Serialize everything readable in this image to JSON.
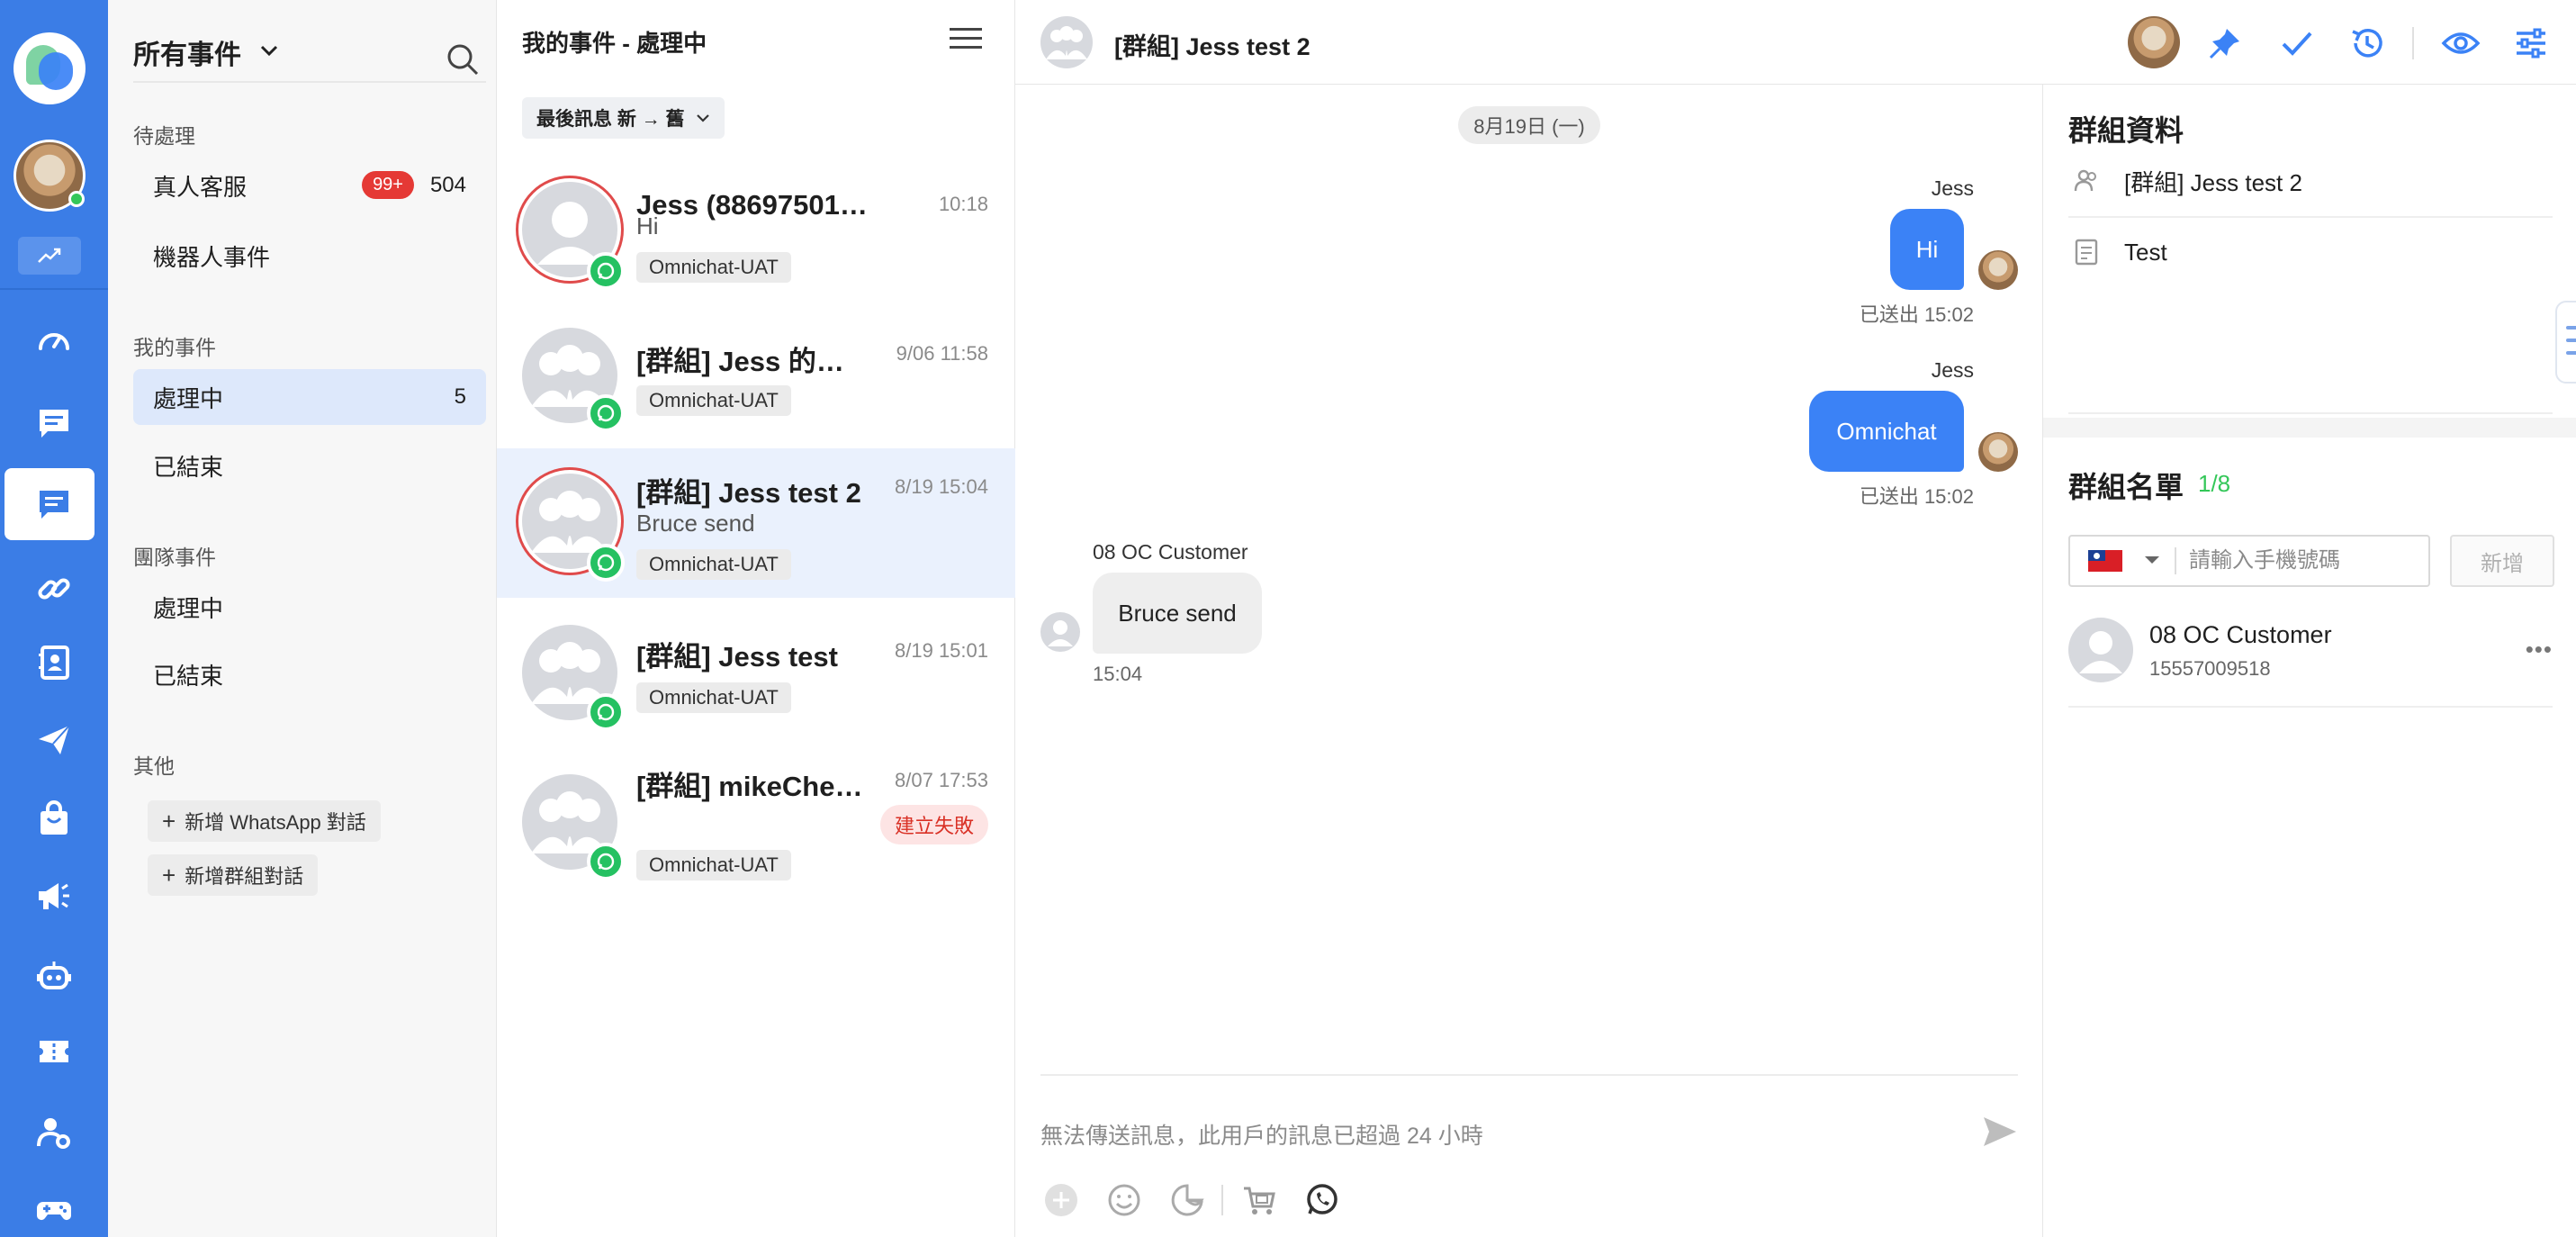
{
  "nav": {
    "title": "所有事件",
    "pending_label": "待處理",
    "pending": [
      {
        "label": "真人客服",
        "badge": "99+",
        "count": "504"
      },
      {
        "label": "機器人事件"
      }
    ],
    "mine_label": "我的事件",
    "mine": [
      {
        "label": "處理中",
        "count": "5"
      },
      {
        "label": "已結束"
      }
    ],
    "team_label": "團隊事件",
    "team": [
      {
        "label": "處理中"
      },
      {
        "label": "已結束"
      }
    ],
    "other_label": "其他",
    "buttons": [
      "新增 WhatsApp 對話",
      "新增群組對話"
    ]
  },
  "list": {
    "title": "我的事件 - 處理中",
    "sort": "最後訊息 新 → 舊",
    "items": [
      {
        "name": "Jess (886975012…",
        "time": "10:18",
        "preview": "Hi",
        "channel": "Omnichat-UAT"
      },
      {
        "name": "[群組] Jess 的群組",
        "time": "9/06 11:58",
        "channel": "Omnichat-UAT"
      },
      {
        "name": "[群組] Jess test 2",
        "time": "8/19 15:04",
        "preview": "Bruce send",
        "channel": "Omnichat-UAT"
      },
      {
        "name": "[群組] Jess test",
        "time": "8/19 15:01",
        "channel": "Omnichat-UAT"
      },
      {
        "name": "[群組] mikeChen…",
        "time": "8/07 17:53",
        "status": "建立失敗",
        "channel": "Omnichat-UAT"
      }
    ]
  },
  "chat": {
    "title": "[群組] Jess test 2",
    "date": "8月19日 (一)",
    "messages": [
      {
        "sender": "Jess",
        "text": "Hi",
        "meta": "已送出 15:02"
      },
      {
        "sender": "Jess",
        "text": "Omnichat",
        "meta": "已送出 15:02"
      },
      {
        "sender": "08 OC Customer",
        "text": "Bruce send",
        "meta": "15:04"
      }
    ],
    "composer_placeholder": "無法傳送訊息，此用戶的訊息已超過 24 小時"
  },
  "info": {
    "title": "群組資料",
    "group_name": "[群組] Jess test 2",
    "description": "Test",
    "members_title": "群組名單",
    "members_count": "1/8",
    "phone_placeholder": "請輸入手機號碼",
    "add_label": "新增",
    "members": [
      {
        "name": "08 OC Customer",
        "phone": "15557009518"
      }
    ]
  },
  "colors": {
    "rail": "#3b7de6",
    "accent": "#3b82f6",
    "badge": "#e53935",
    "whatsapp": "#25c162"
  }
}
